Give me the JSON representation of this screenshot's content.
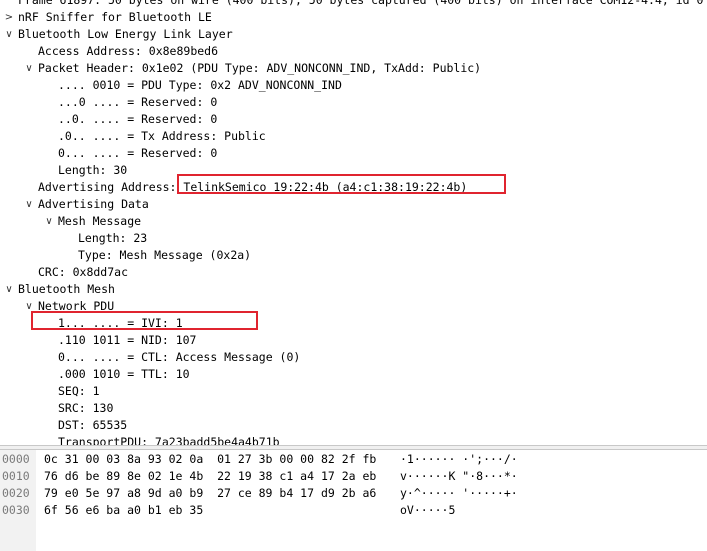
{
  "tree": [
    {
      "text": "Frame 61897: 50 bytes on wire (400 bits), 50 bytes captured (400 bits) on interface COM12-4.4, id 0",
      "indent": 0,
      "twisty": "none"
    },
    {
      "text": "nRF Sniffer for Bluetooth LE",
      "indent": 0,
      "twisty": "collapsed"
    },
    {
      "text": "Bluetooth Low Energy Link Layer",
      "indent": 0,
      "twisty": "expanded"
    },
    {
      "text": "Access Address: 0x8e89bed6",
      "indent": 1,
      "twisty": "none"
    },
    {
      "text": "Packet Header: 0x1e02 (PDU Type: ADV_NONCONN_IND, TxAdd: Public)",
      "indent": 1,
      "twisty": "expanded"
    },
    {
      "text": ".... 0010 = PDU Type: 0x2 ADV_NONCONN_IND",
      "indent": 2,
      "twisty": "none"
    },
    {
      "text": "...0 .... = Reserved: 0",
      "indent": 2,
      "twisty": "none"
    },
    {
      "text": "..0. .... = Reserved: 0",
      "indent": 2,
      "twisty": "none"
    },
    {
      "text": ".0.. .... = Tx Address: Public",
      "indent": 2,
      "twisty": "none"
    },
    {
      "text": "0... .... = Reserved: 0",
      "indent": 2,
      "twisty": "none"
    },
    {
      "text": "Length: 30",
      "indent": 2,
      "twisty": "none"
    },
    {
      "text": "Advertising Address: TelinkSemico_19:22:4b (a4:c1:38:19:22:4b)",
      "indent": 1,
      "twisty": "none",
      "selected": true
    },
    {
      "text": "Advertising Data",
      "indent": 1,
      "twisty": "expanded"
    },
    {
      "text": "Mesh Message",
      "indent": 2,
      "twisty": "expanded"
    },
    {
      "text": "Length: 23",
      "indent": 3,
      "twisty": "none"
    },
    {
      "text": "Type: Mesh Message (0x2a)",
      "indent": 3,
      "twisty": "none"
    },
    {
      "text": "CRC: 0x8dd7ac",
      "indent": 1,
      "twisty": "none"
    },
    {
      "text": "Bluetooth Mesh",
      "indent": 0,
      "twisty": "expanded"
    },
    {
      "text": "Network PDU",
      "indent": 1,
      "twisty": "expanded"
    },
    {
      "text": "1... .... = IVI: 1",
      "indent": 2,
      "twisty": "none"
    },
    {
      "text": ".110 1011 = NID: 107",
      "indent": 2,
      "twisty": "none"
    },
    {
      "text": "0... .... = CTL: Access Message (0)",
      "indent": 2,
      "twisty": "none"
    },
    {
      "text": ".000 1010 = TTL: 10",
      "indent": 2,
      "twisty": "none"
    },
    {
      "text": "SEQ: 1",
      "indent": 2,
      "twisty": "none"
    },
    {
      "text": "SRC: 130",
      "indent": 2,
      "twisty": "none"
    },
    {
      "text": "DST: 65535",
      "indent": 2,
      "twisty": "none"
    },
    {
      "text": "TransportPDU: 7a23badd5be4a4b71b",
      "indent": 2,
      "twisty": "none"
    }
  ],
  "hex": [
    {
      "offset": "0000",
      "bytes": "0c 31 00 03 8a 93 02 0a  01 27 3b 00 00 82 2f fb",
      "ascii": "·1······ ·';···/·"
    },
    {
      "offset": "0010",
      "bytes": "76 d6 be 89 8e 02 1e 4b  22 19 38 c1 a4 17 2a eb",
      "ascii": "v······K \"·8···*·"
    },
    {
      "offset": "0020",
      "bytes": "79 e0 5e 97 a8 9d a0 b9  27 ce 89 b4 17 d9 2b a6",
      "ascii": "y·^····· '·····+·"
    },
    {
      "offset": "0030",
      "bytes": "6f 56 e6 ba a0 b1 eb 35",
      "ascii": "oV·····5"
    }
  ],
  "icons": {
    "expanded": "chevron-down-icon",
    "collapsed": "chevron-right-icon"
  },
  "colors": {
    "highlight_box": "#e0242f",
    "offset_text": "#7a7a7a"
  }
}
